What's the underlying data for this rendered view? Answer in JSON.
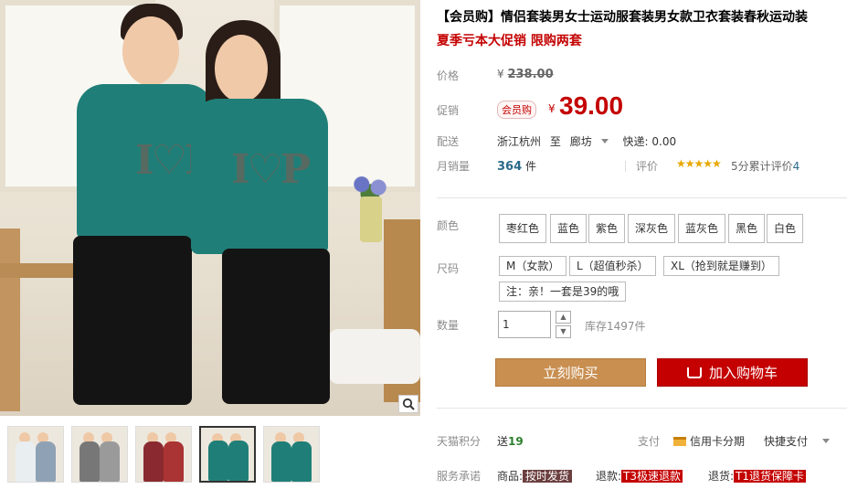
{
  "product": {
    "title": "【会员购】情侣套装男女士运动服套装男女款卫衣套装春秋运动装",
    "subtitle": "夏季亏本大促销 限购两套"
  },
  "pricing": {
    "list_label": "价格",
    "currency": "¥",
    "original_price": "238.00",
    "promo_label": "促销",
    "promo_badge": "会员购",
    "promo_price": "39.00"
  },
  "shipping": {
    "label": "配送",
    "from": "浙江杭州",
    "to_word": "至",
    "destination": "廊坊",
    "fee": "快递: 0.00"
  },
  "sales": {
    "label": "月销量",
    "count": "364",
    "unit": "件",
    "review_label": "评价",
    "stars": "★★★★★",
    "rating_text": "5分累计评价",
    "review_count": "4"
  },
  "options": {
    "color_label": "颜色",
    "colors": [
      "枣红色",
      "蓝色",
      "紫色",
      "深灰色",
      "蓝灰色",
      "黑色",
      "白色"
    ],
    "size_label": "尺码",
    "sizes": [
      "M（女款）",
      "L（超值秒杀）",
      "XL（抢到就是赚到）"
    ],
    "size_note": "注：亲！一套是39的哦"
  },
  "quantity": {
    "label": "数量",
    "value": "1",
    "up": "▲",
    "down": "▼",
    "stock": "库存1497件"
  },
  "actions": {
    "buy_now": "立刻购买",
    "add_to_cart": "加入购物车"
  },
  "points": {
    "label": "天猫积分",
    "give": "送",
    "value": "19",
    "pay_label": "支付",
    "credit": "信用卡分期",
    "quick_pay": "快捷支付"
  },
  "service": {
    "label": "服务承诺",
    "goods": "商品:",
    "goods_tag": "按时发货",
    "refund": "退款:",
    "refund_tag": "T3极速退款",
    "return": "退货:",
    "return_tag": "T1退货保障卡"
  },
  "image": {
    "shirt_logo": "I♡P"
  },
  "colors": {
    "accent_red": "#c40000",
    "buy_button": "#c88f51",
    "cart_button": "#c40000",
    "link_blue": "#2b6a8b"
  }
}
